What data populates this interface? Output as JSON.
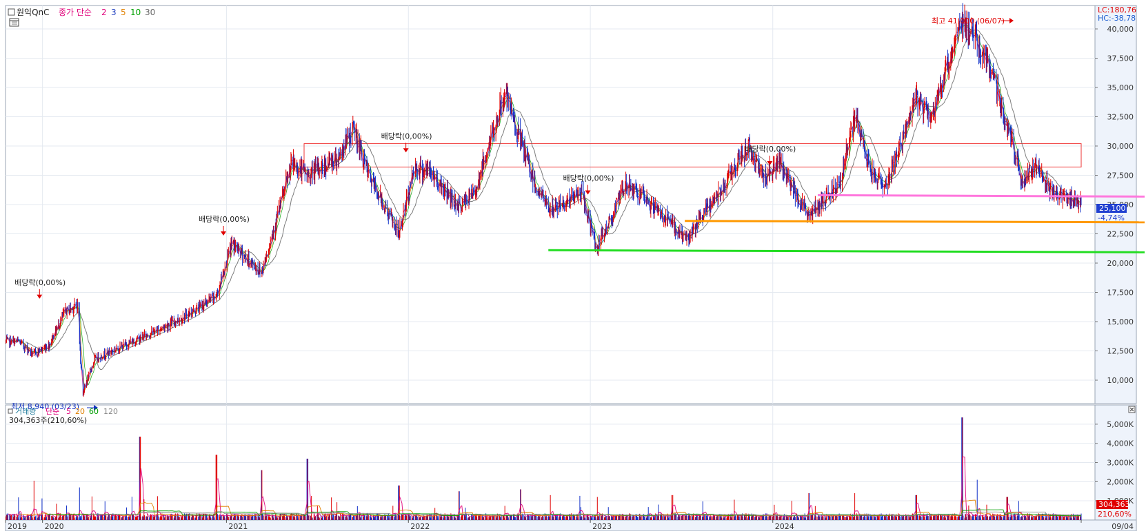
{
  "chart_data": [
    {
      "type": "candlestick",
      "instrument": "원익QnC",
      "legend": {
        "prefix": "종가 단순",
        "periods": [
          "2",
          "3",
          "5",
          "10",
          "30"
        ],
        "colors": [
          "#e0007a",
          "#1f3fbf",
          "#e08000",
          "#00a000",
          "#666666"
        ]
      },
      "x_ticks": [
        "2019",
        "2020",
        "2021",
        "2022",
        "2023",
        "2024",
        "09/04"
      ],
      "y_ticks": [
        "10,000",
        "12,500",
        "15,000",
        "17,500",
        "20,000",
        "22,500",
        "25,000",
        "27,500",
        "30,000",
        "32,500",
        "35,000",
        "37,500",
        "40,000"
      ],
      "ylim": [
        8000,
        42000
      ],
      "price_path": [
        [
          "2019-11",
          13300
        ],
        [
          "2019-12",
          12200
        ],
        [
          "2020-01",
          13000
        ],
        [
          "2020-02",
          15800
        ],
        [
          "2020-03",
          16500
        ],
        [
          "2020-03-10",
          16700
        ],
        [
          "2020-03-23",
          8940
        ],
        [
          "2020-04",
          11800
        ],
        [
          "2020-06",
          13000
        ],
        [
          "2020-08",
          14200
        ],
        [
          "2020-10",
          15500
        ],
        [
          "2020-12",
          17200
        ],
        [
          "2021-01",
          21700
        ],
        [
          "2021-02",
          20300
        ],
        [
          "2021-03",
          19200
        ],
        [
          "2021-05",
          28500
        ],
        [
          "2021-06",
          27500
        ],
        [
          "2021-08",
          29000
        ],
        [
          "2021-09",
          31500
        ],
        [
          "2021-10",
          27500
        ],
        [
          "2021-12",
          22500
        ],
        [
          "2022-01",
          28200
        ],
        [
          "2022-02",
          27800
        ],
        [
          "2022-04",
          24800
        ],
        [
          "2022-05",
          26000
        ],
        [
          "2022-07",
          34500
        ],
        [
          "2022-09",
          26500
        ],
        [
          "2022-10",
          24500
        ],
        [
          "2022-12",
          26000
        ],
        [
          "2023-01",
          21200
        ],
        [
          "2023-03",
          26800
        ],
        [
          "2023-05",
          24500
        ],
        [
          "2023-07",
          22000
        ],
        [
          "2023-09",
          26000
        ],
        [
          "2023-11",
          30000
        ],
        [
          "2023-12",
          27300
        ],
        [
          "2024-01",
          28500
        ],
        [
          "2024-03",
          24000
        ],
        [
          "2024-05",
          27000
        ],
        [
          "2024-06",
          32500
        ],
        [
          "2024-07",
          28000
        ],
        [
          "2024-08",
          26500
        ],
        [
          "2024-10",
          34000
        ],
        [
          "2024-11",
          32500
        ],
        [
          "2025-01",
          41000
        ],
        [
          "2025-03",
          36500
        ],
        [
          "2025-05",
          27000
        ],
        [
          "2025-06",
          28500
        ],
        [
          "2025-07",
          26000
        ],
        [
          "2025-09",
          25100
        ]
      ],
      "annotations": {
        "high": "최고 41,000 (06/07)",
        "low": "최저 8,940 (03/23)",
        "dividend": "배당락(0,00%)"
      },
      "last_price": "25,100",
      "last_change": "-4,74%",
      "lc": "LC:180,76",
      "hc": "HC:-38,78",
      "horizontal_lines": [
        {
          "name": "green-support",
          "value": 21100,
          "color": "#22dd22"
        },
        {
          "name": "orange-support",
          "value": 23600,
          "color": "#ff9900"
        },
        {
          "name": "pink-support",
          "value": 25800,
          "color": "#ff77dd"
        }
      ],
      "box": {
        "low": 28200,
        "high": 30200,
        "color": "#ee3333"
      }
    },
    {
      "type": "bar",
      "title": "거래량",
      "legend": {
        "prefix": "단순",
        "periods": [
          "5",
          "20",
          "60",
          "120"
        ],
        "colors": [
          "#e0007a",
          "#e08000",
          "#00a000",
          "#888888"
        ]
      },
      "summary": "304,363주(210,60%)",
      "y_ticks": [
        "1,000K",
        "2,000K",
        "3,000K",
        "4,000K",
        "5,000K"
      ],
      "ylim": [
        0,
        5500000
      ],
      "last_volume": "304,363",
      "last_ratio": "210,60%",
      "spikes": [
        [
          "2019-12",
          2050000
        ],
        [
          "2020-03",
          1700000
        ],
        [
          "2020-07",
          4350000
        ],
        [
          "2020-12",
          3400000
        ],
        [
          "2021-03",
          2600000
        ],
        [
          "2021-06",
          3200000
        ],
        [
          "2021-12",
          1800000
        ],
        [
          "2022-04",
          1500000
        ],
        [
          "2022-08",
          1600000
        ],
        [
          "2022-10",
          1300000
        ],
        [
          "2023-01",
          1200000
        ],
        [
          "2023-06",
          1300000
        ],
        [
          "2024-03",
          1400000
        ],
        [
          "2024-06",
          1400000
        ],
        [
          "2024-10",
          1300000
        ],
        [
          "2025-01",
          5350000
        ],
        [
          "2025-02",
          2100000
        ],
        [
          "2025-04",
          1200000
        ]
      ]
    }
  ]
}
